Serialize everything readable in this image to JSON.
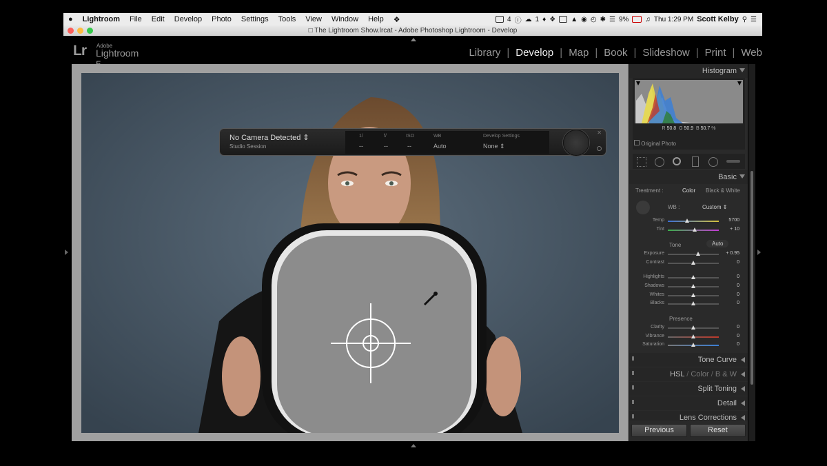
{
  "menubar": {
    "apple": "",
    "items": [
      "Lightroom",
      "File",
      "Edit",
      "Develop",
      "Photo",
      "Settings",
      "Tools",
      "View",
      "Window",
      "Help"
    ],
    "status": {
      "badge_count": "4",
      "cloud_count": "1",
      "battery": "9%",
      "clock": "Thu 1:29 PM",
      "user": "Scott Kelby"
    }
  },
  "window": {
    "title": "The Lightroom Show.lrcat - Adobe Photoshop Lightroom - Develop"
  },
  "identity": {
    "mark": "Lr",
    "small": "Adobe",
    "name": "Lightroom 5"
  },
  "modules": [
    "Library",
    "Develop",
    "Map",
    "Book",
    "Slideshow",
    "Print",
    "Web"
  ],
  "active_module": "Develop",
  "tether": {
    "camera": "No Camera Detected",
    "session": "Studio Session",
    "shutter_label": "1/",
    "shutter_value": "--",
    "aperture_label": "f/",
    "aperture_value": "--",
    "iso_label": "ISO",
    "iso_value": "--",
    "wb_label": "WB",
    "wb_value": "Auto",
    "develop_label": "Develop Settings",
    "develop_value": "None"
  },
  "histogram": {
    "title": "Histogram",
    "r_label": "R",
    "r": "50.8",
    "g_label": "G",
    "g": "50.9",
    "b_label": "B",
    "b": "50.7",
    "unit": "%",
    "original_photo": "Original Photo"
  },
  "basic": {
    "title": "Basic",
    "treatment_label": "Treatment :",
    "treatment_color": "Color",
    "treatment_bw": "Black & White",
    "wb_label": "WB :",
    "wb_value": "Custom",
    "tone_label": "Tone",
    "auto_label": "Auto",
    "presence_label": "Presence",
    "sliders": [
      {
        "name": "Temp",
        "value": "5700",
        "pos": 0.38
      },
      {
        "name": "Tint",
        "value": "+ 10",
        "pos": 0.53
      },
      {
        "name": "Exposure",
        "value": "+ 0.95",
        "pos": 0.59
      },
      {
        "name": "Contrast",
        "value": "0",
        "pos": 0.5
      },
      {
        "name": "Highlights",
        "value": "0",
        "pos": 0.5
      },
      {
        "name": "Shadows",
        "value": "0",
        "pos": 0.5
      },
      {
        "name": "Whites",
        "value": "0",
        "pos": 0.5
      },
      {
        "name": "Blacks",
        "value": "0",
        "pos": 0.5
      },
      {
        "name": "Clarity",
        "value": "0",
        "pos": 0.5
      },
      {
        "name": "Vibrance",
        "value": "0",
        "pos": 0.5
      },
      {
        "name": "Saturation",
        "value": "0",
        "pos": 0.5
      }
    ]
  },
  "panels": {
    "tone_curve": "Tone Curve",
    "hsl": "HSL",
    "color": "Color",
    "bw": "B & W",
    "split_toning": "Split Toning",
    "detail": "Detail",
    "lens_corrections": "Lens Corrections"
  },
  "buttons": {
    "previous": "Previous",
    "reset": "Reset"
  },
  "colors": {
    "accent_active": "#f0f0f0",
    "panel_bg": "#2a2a2a",
    "backdrop": "#4b5b6a",
    "reflector": "#8c8c8c"
  }
}
